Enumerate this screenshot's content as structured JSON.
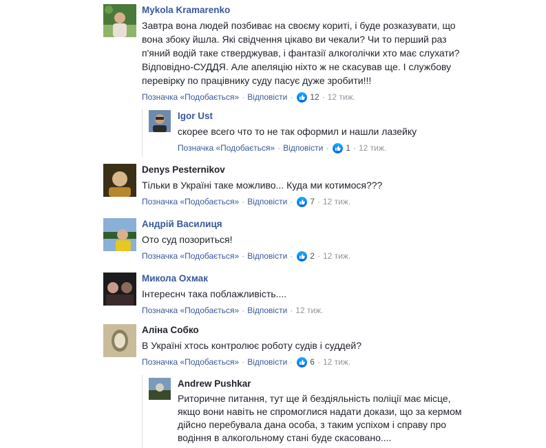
{
  "labels": {
    "like": "Позначка «Подобається»",
    "reply": "Відповісти",
    "separator": "·"
  },
  "comments": [
    {
      "author": "Mykola Kramarenko",
      "text": "Завтра вона людей позбиває на своєму кориті, і буде розказувати, що\nвона збоку йшла. Які свідчення цікаво ви чекали? Чи то перший раз\nп'яний водій таке стверджував, і фантазії алкоголічки хто має слухати?\nВідповідно-СУДДЯ. Але апеляцію ніхто ж не скасував ще. І службову\nперевірку по працівнику суду пасує дуже зробити!!!",
      "likes": "12",
      "time": "12 тиж.",
      "avatar_colors": [
        "#4a7a3a",
        "#8fb46a",
        "#e8e0d4"
      ]
    },
    {
      "author": "Igor Ust",
      "text": "скорее всего что то не так оформил и нашли лазейку",
      "likes": "1",
      "time": "12 тиж.",
      "avatar_colors": [
        "#6b8bb0",
        "#c9a07a",
        "#2b2b2b"
      ]
    },
    {
      "author": "Denys Pesternikov",
      "text": "Тільки в Україні таке можливо... Куда ми котимося???",
      "likes": "7",
      "time": "12 тиж.",
      "avatar_colors": [
        "#3a3018",
        "#b8862e",
        "#d6b88a"
      ]
    },
    {
      "author": "Андрій Василиця",
      "text": "Ото суд позориться!",
      "likes": "2",
      "time": "12 тиж.",
      "avatar_colors": [
        "#8ab0d8",
        "#2f5e2a",
        "#e6c820"
      ]
    },
    {
      "author": "Микола Охмак",
      "text": "Інтереснч така поблажливість....",
      "likes": "",
      "time": "12 тиж.",
      "avatar_colors": [
        "#1c1c1c",
        "#c89a8a",
        "#8a6a5a"
      ]
    },
    {
      "author": "Аліна Собко",
      "text": "В Україні хтось контролює роботу судів і суддей?",
      "likes": "6",
      "time": "12 тиж.",
      "avatar_colors": [
        "#c8bc9a",
        "#8a8060",
        "#e8e0c8"
      ]
    },
    {
      "author": "Andrew Pushkar",
      "text": "Риторичне питання, тут ще й бездіяльність поліції має місце,\nякщо вони навіть не спромоглися надати докази, що за кермом\nдійсно перебувала дана особа, з таким успіхом і справу про\nводіння в алкогольному стані буде скасовано....",
      "likes": "",
      "time": "",
      "avatar_colors": [
        "#7a9ab8",
        "#d4d0c0",
        "#3a4a2a"
      ]
    }
  ]
}
